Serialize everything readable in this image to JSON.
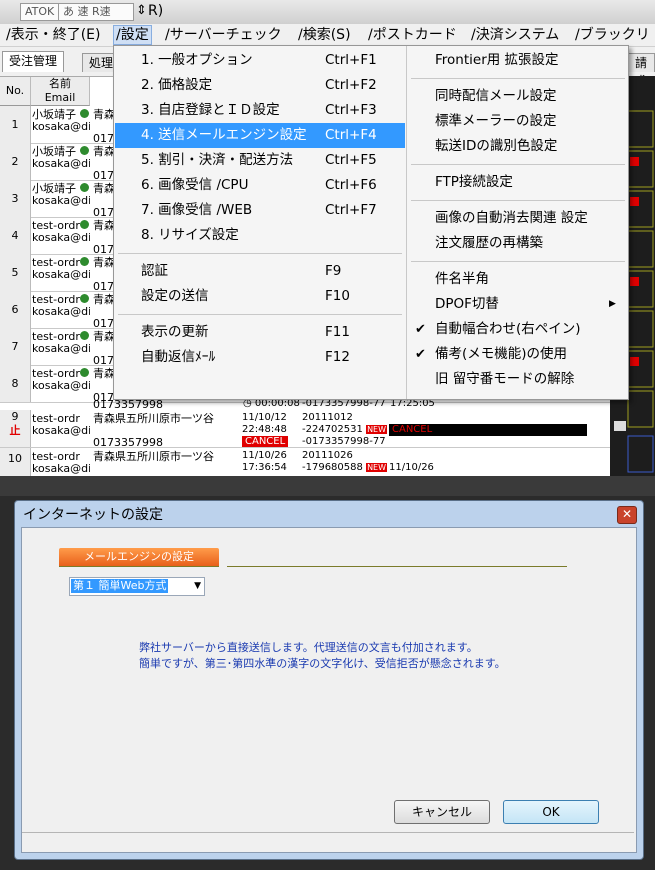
{
  "titlebar": {
    "ime_label": "ATOK",
    "ime_modes": "あ 速 R速",
    "ime_arrow": "⇕",
    "title_fragment": "R)"
  },
  "menubar": {
    "items": [
      "/表示・終了(E)",
      "/設定",
      "/サーバーチェック",
      "/検索(S)",
      "/ポストカード",
      "/決済システム",
      "/ブラックリ"
    ]
  },
  "tabs": [
    "受注管理",
    "処理",
    "請求"
  ],
  "grid": {
    "headers": {
      "no": "No.",
      "name": "名前",
      "email": "Email"
    },
    "rows": [
      {
        "no": "1",
        "name": "小坂靖子",
        "email": "kosaka@di",
        "addr": "青森",
        "tel": "017"
      },
      {
        "no": "2",
        "name": "小坂靖子",
        "email": "kosaka@di",
        "addr": "青森",
        "tel": "017"
      },
      {
        "no": "3",
        "name": "小坂靖子",
        "email": "kosaka@di",
        "addr": "青森",
        "tel": "017"
      },
      {
        "no": "4",
        "name": "test-ordr",
        "email": "kosaka@di",
        "addr": "青森",
        "tel": "017"
      },
      {
        "no": "5",
        "name": "test-ordr",
        "email": "kosaka@di",
        "addr": "青森",
        "tel": "017"
      },
      {
        "no": "6",
        "name": "test-ordr",
        "email": "kosaka@di",
        "addr": "青森",
        "tel": "017"
      },
      {
        "no": "7",
        "name": "test-ordr",
        "email": "kosaka@di",
        "addr": "青森",
        "tel": "017"
      },
      {
        "no": "8",
        "name": "test-ordr",
        "email": "kosaka@di",
        "addr": "青森",
        "tel": "017"
      }
    ],
    "row8_extra": {
      "tel": "0173357998",
      "time": "00:00:08",
      "order": "-0173357998-77",
      "clock": "17:25:05"
    },
    "row9": {
      "no": "9",
      "stop": "止",
      "name": "test-ordr",
      "email": "kosaka@di",
      "addr": "青森県五所川原市一ツ谷",
      "tel": "0173357998",
      "date": "11/10/12",
      "time": "22:48:48",
      "cancel": "CANCEL",
      "order_no": "20111012",
      "order_id": "-224702531",
      "new": "NEW",
      "order2": "-0173357998-77",
      "cancel2": "CANCEL"
    },
    "row10": {
      "no": "10",
      "name": "test-ordr",
      "email": "kosaka@di",
      "addr": "青森県五所川原市一ツ谷",
      "date": "11/10/26",
      "time": "17:36:54",
      "order_no": "20111026",
      "order_id": "-179680588",
      "new": "NEW",
      "date2": "11/10/26"
    }
  },
  "settings_menu": {
    "col1": [
      {
        "label": "1. 一般オプション",
        "shortcut": "Ctrl+F1"
      },
      {
        "label": "2. 価格設定",
        "shortcut": "Ctrl+F2"
      },
      {
        "label": "3. 自店登録とＩＤ設定",
        "shortcut": "Ctrl+F3"
      },
      {
        "label": "4. 送信メールエンジン設定",
        "shortcut": "Ctrl+F4"
      },
      {
        "label": "5. 割引・決済・配送方法",
        "shortcut": "Ctrl+F5"
      },
      {
        "label": "6. 画像受信 /CPU",
        "shortcut": "Ctrl+F6"
      },
      {
        "label": "7. 画像受信 /WEB",
        "shortcut": "Ctrl+F7"
      },
      {
        "label": "8. リサイズ設定",
        "shortcut": ""
      },
      {
        "label": "認証",
        "shortcut": "F9"
      },
      {
        "label": "設定の送信",
        "shortcut": "F10"
      },
      {
        "label": "表示の更新",
        "shortcut": "F11"
      },
      {
        "label": "自動返信ﾒｰﾙ",
        "shortcut": "F12"
      }
    ],
    "highlighted_index": 3,
    "col2": [
      {
        "label": "Frontier用 拡張設定"
      },
      {
        "label": "同時配信メール設定"
      },
      {
        "label": "標準メーラーの設定"
      },
      {
        "label": "転送IDの識別色設定"
      },
      {
        "label": "FTP接続設定"
      },
      {
        "label": "画像の自動消去関連 設定"
      },
      {
        "label": "注文履歴の再構築"
      },
      {
        "label": "件名半角"
      },
      {
        "label": "DPOF切替",
        "submenu_arrow": "▶"
      },
      {
        "label": "自動幅合わせ(右ペイン)",
        "check": "✔"
      },
      {
        "label": "備考(メモ機能)の使用",
        "check": "✔"
      },
      {
        "label": "旧 留守番モードの解除"
      }
    ]
  },
  "dialog": {
    "title": "インターネットの設定",
    "close_glyph": "✕",
    "section_label": "メールエンジンの設定",
    "engine_selected": "第１ 簡単Web方式",
    "engine_arrow": "▼",
    "description_1": "弊社サーバーから直接送信します。代理送信の文言も付加されます。",
    "description_2": "簡単ですが、第三･第四水準の漢字の文字化け、受信拒否が懸念されます。",
    "cancel_label": "キャンセル",
    "ok_label": "OK"
  }
}
